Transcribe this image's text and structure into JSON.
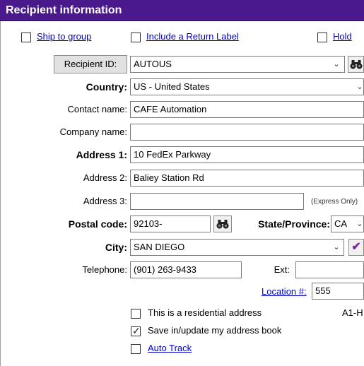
{
  "header": {
    "title": "Recipient information"
  },
  "top_options": {
    "ship_to_group": "Ship to group",
    "include_return": "Include a Return Label",
    "hold": "Hold"
  },
  "recipient": {
    "id_button": "Recipient ID:",
    "id_value": "AUTOUS",
    "country_label": "Country:",
    "country_value": "US - United States",
    "contact_label": "Contact name:",
    "contact_value": "CAFE Automation",
    "company_label": "Company name:",
    "company_value": "",
    "address1_label": "Address 1:",
    "address1_value": "10 FedEx Parkway",
    "address2_label": "Address 2:",
    "address2_value": "Baliey Station Rd",
    "address3_label": "Address 3:",
    "address3_value": "",
    "address3_note": "(Express Only)",
    "postal_label": "Postal code:",
    "postal_value": "92103-",
    "state_label": "State/Province:",
    "state_value": "CA",
    "city_label": "City:",
    "city_value": "SAN DIEGO",
    "telephone_label": "Telephone:",
    "telephone_value": "(901) 263-9433",
    "ext_label": "Ext:",
    "ext_value": "",
    "location_label": "Location #:",
    "location_value": "555",
    "code_text": "A1-H"
  },
  "options": {
    "residential": "This is a residential address",
    "residential_checked": false,
    "save_address": "Save in/update my address book",
    "save_address_checked": true,
    "auto_track": "Auto Track",
    "auto_track_checked": false
  },
  "icons": {
    "lookup": "binoculars-icon",
    "validate": "checkmark-icon",
    "dropdown": "chevron-down-icon"
  },
  "colors": {
    "header_bg": "#4a1a8c",
    "link": "#0000cc",
    "check_accent": "#7b2a9c"
  }
}
